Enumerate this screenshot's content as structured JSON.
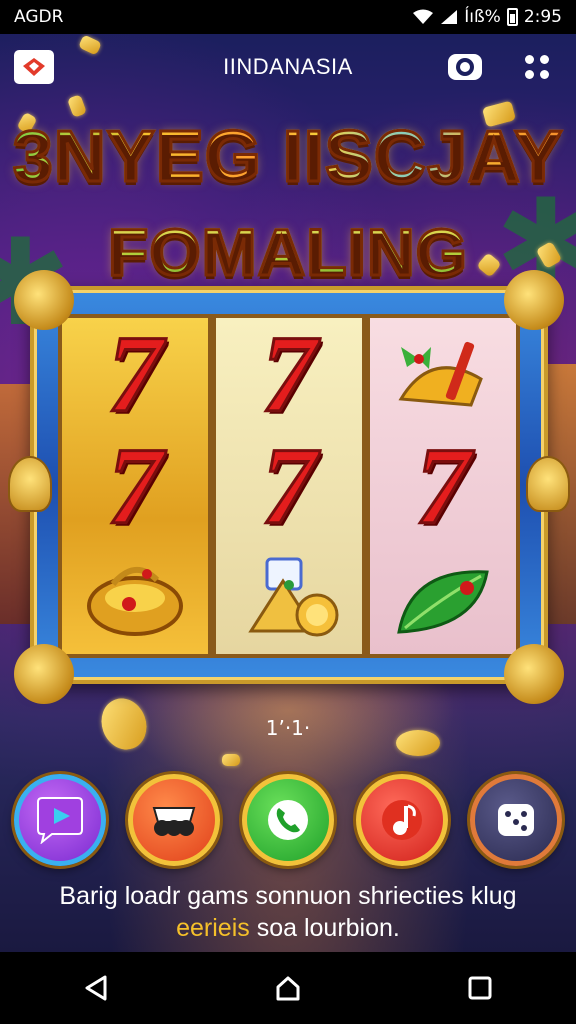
{
  "status_bar": {
    "carrier": "AGDR",
    "network": "Íıß%",
    "time": "2:95"
  },
  "header": {
    "brand": "IINDANASIA",
    "icons": [
      "logo-icon",
      "camera-icon",
      "grid-menu-icon"
    ]
  },
  "title": {
    "line1": "3NYEG IISCJAY",
    "line2": "FOMALING"
  },
  "slot": {
    "reels": [
      [
        "7",
        "7",
        "purse"
      ],
      [
        "7",
        "7",
        "tent-coin"
      ],
      [
        "bell",
        "7",
        "leaf"
      ]
    ]
  },
  "counter": "1’·1·",
  "actions": [
    {
      "name": "play",
      "icon": "chat-play-icon"
    },
    {
      "name": "cards",
      "icon": "cards-icon"
    },
    {
      "name": "call",
      "icon": "phone-icon"
    },
    {
      "name": "music",
      "icon": "music-note-icon"
    },
    {
      "name": "dice",
      "icon": "dice-icon"
    }
  ],
  "caption": {
    "line1": "Barig loadr gams sonnuon shriecties klug",
    "line2_highlight": "eerieis",
    "line2_rest": " soa lourbion."
  },
  "colors": {
    "accent_gold": "#f2c23a",
    "seven_red": "#e41d1d",
    "frame_blue": "#1e4fb0"
  }
}
